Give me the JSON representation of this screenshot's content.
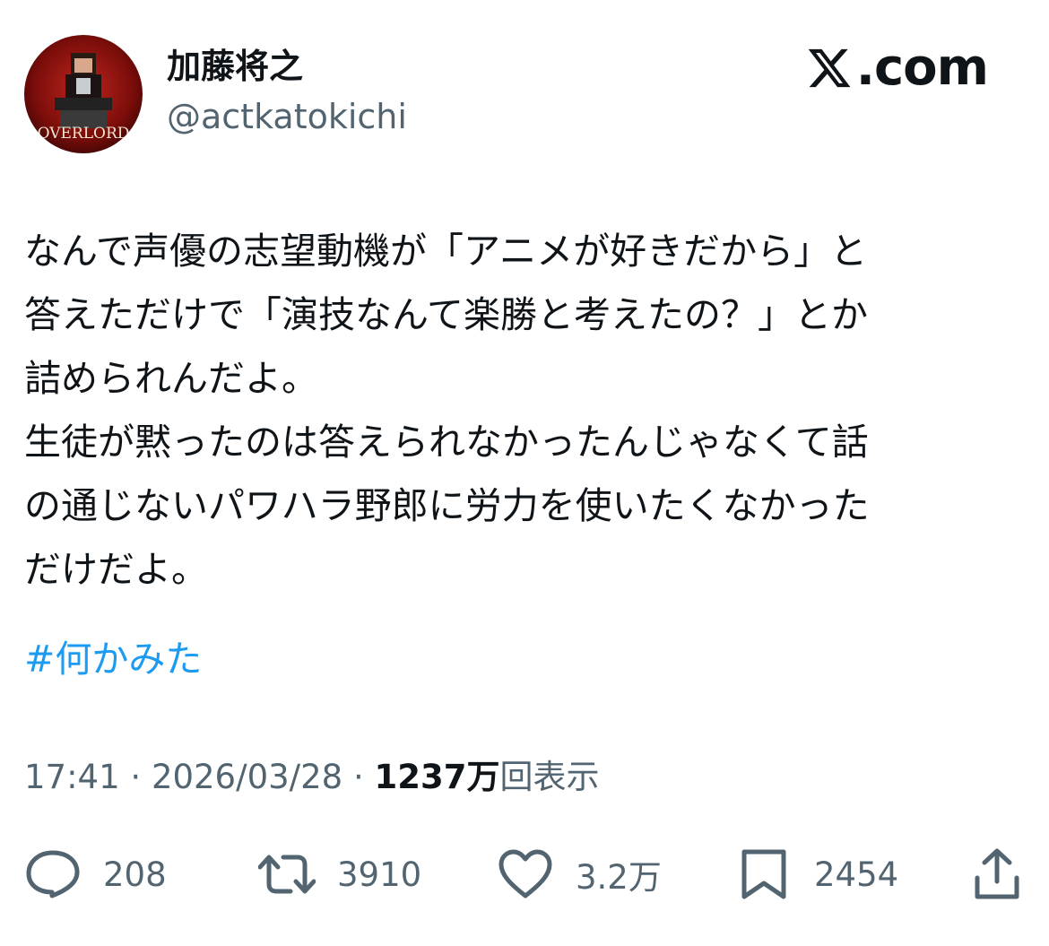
{
  "author": {
    "display_name": "加藤将之",
    "handle": "@actkatokichi",
    "avatar_text": "OVERLORD"
  },
  "brand": {
    "text": ".com"
  },
  "tweet": {
    "text": "なんで声優の志望動機が「アニメが好きだから」と\n答えただけで「演技なんて楽勝と考えたの？」とか\n詰められんだよ。\n生徒が黙ったのは答えられなかったんじゃなくて話\nの通じないパワハラ野郎に労力を使いたくなかった\nだけだよ。",
    "hashtag": "#何かみた"
  },
  "meta": {
    "time": "17:41",
    "separator": "·",
    "date": "2026/03/28",
    "views_count": "1237万",
    "views_label": "回表示"
  },
  "actions": {
    "replies": "208",
    "retweets": "3910",
    "likes": "3.2万",
    "bookmarks": "2454"
  },
  "colors": {
    "text": "#0f1419",
    "secondary": "#536471",
    "link": "#1d9bf0"
  }
}
